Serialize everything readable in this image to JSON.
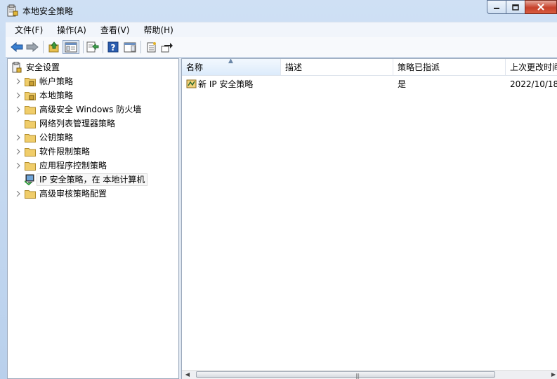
{
  "window": {
    "title": "本地安全策略"
  },
  "menu": [
    "文件(F)",
    "操作(A)",
    "查看(V)",
    "帮助(H)"
  ],
  "toolbar": {
    "buttons": [
      "back-icon",
      "forward-icon",
      "up-folder-icon",
      "show-hide-tree-icon",
      "export-list-icon",
      "help-icon",
      "show-hide-action-pane-icon",
      "properties-icon",
      "refresh-icon"
    ]
  },
  "tree": {
    "root": "安全设置",
    "items": [
      {
        "label": "帐户策略",
        "icon": "locked-folder-icon",
        "expandable": true
      },
      {
        "label": "本地策略",
        "icon": "locked-folder-icon",
        "expandable": true
      },
      {
        "label": "高级安全 Windows 防火墙",
        "icon": "folder-icon",
        "expandable": true
      },
      {
        "label": "网络列表管理器策略",
        "icon": "folder-icon",
        "expandable": false
      },
      {
        "label": "公钥策略",
        "icon": "folder-icon",
        "expandable": true
      },
      {
        "label": "软件限制策略",
        "icon": "folder-icon",
        "expandable": true
      },
      {
        "label": "应用程序控制策略",
        "icon": "folder-icon",
        "expandable": true
      },
      {
        "label": "IP 安全策略，在 本地计算机",
        "icon": "computer-policy-icon",
        "expandable": false,
        "selected": true
      },
      {
        "label": "高级审核策略配置",
        "icon": "folder-icon",
        "expandable": true
      }
    ]
  },
  "list": {
    "columns": [
      "名称",
      "描述",
      "策略已指派",
      "上次更改时间"
    ],
    "rows": [
      {
        "name": "新 IP 安全策略",
        "description": "",
        "assigned": "是",
        "modified": "2022/10/18"
      }
    ]
  }
}
